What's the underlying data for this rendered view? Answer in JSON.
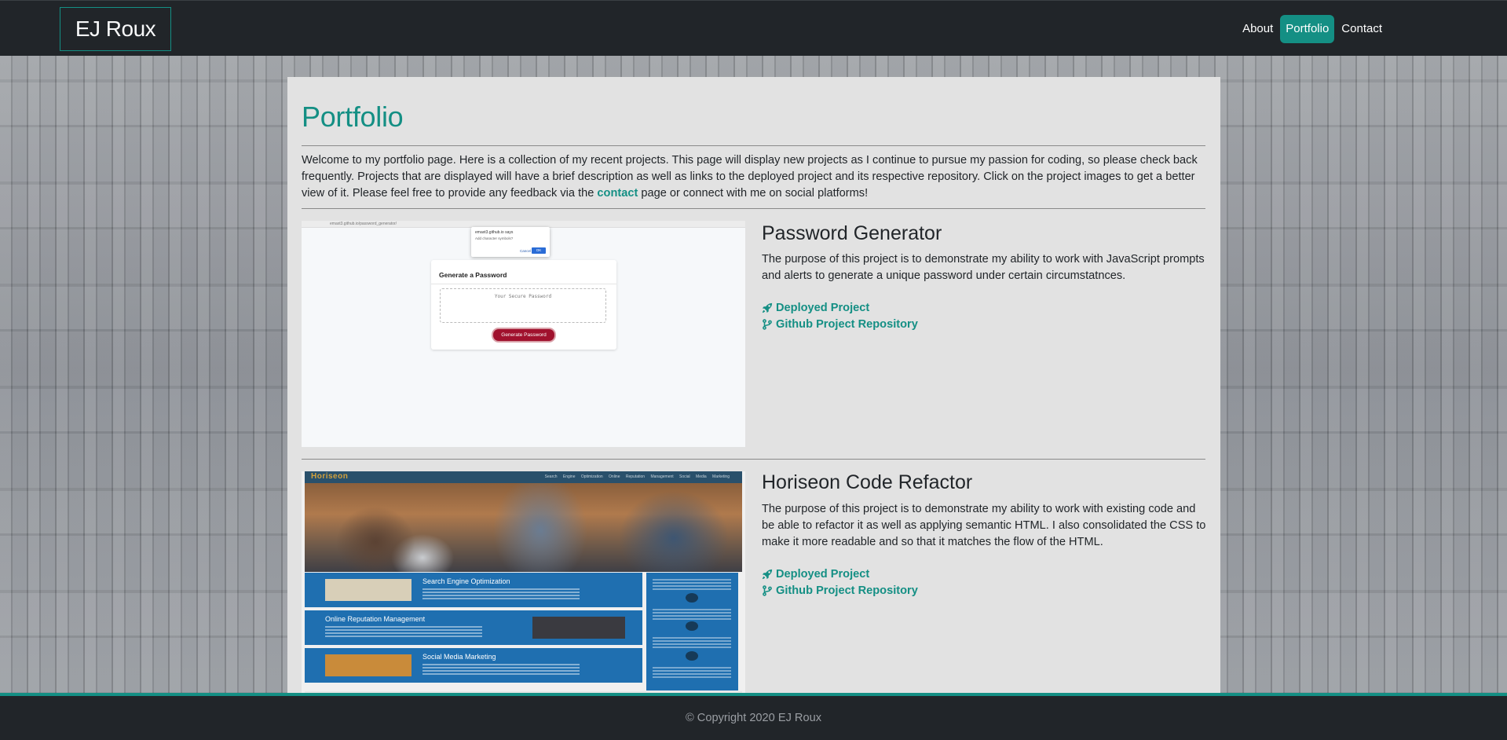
{
  "navbar": {
    "brand": "EJ Roux",
    "links": [
      {
        "label": "About",
        "active": false
      },
      {
        "label": "Portfolio",
        "active": true
      },
      {
        "label": "Contact",
        "active": false
      }
    ]
  },
  "main": {
    "title": "Portfolio",
    "intro_before": "Welcome to my portfolio page. Here is a collection of my recent projects. This page will display new projects as I continue to pursue my passion for coding, so please check back frequently. Projects that are displayed will have a brief description as well as links to the deployed project and its respective repository. Click on the project images to get a better view of it. Please feel free to provide any feedback via the ",
    "intro_link": "contact",
    "intro_after": " page or connect with me on social platforms!",
    "projects": [
      {
        "title": "Password Generator",
        "description": "The purpose of this project is to demonstrate my ability to work with JavaScript prompts and alerts to generate a unique password under certain circumstatnces.",
        "deployed_label": "Deployed Project",
        "repo_label": "Github Project Repository",
        "screenshot": {
          "url": "emaxt3.github.io/password_generator/",
          "alert_title": "emaxt3.github.io says",
          "alert_text": "Add character symbols?",
          "alert_cancel": "Cancel",
          "alert_ok": "OK",
          "card_heading": "Generate a Password",
          "textarea_placeholder": "Your Secure Password",
          "button_label": "Generate Password"
        }
      },
      {
        "title": "Horiseon Code Refactor",
        "description": "The purpose of this project is to demonstrate my ability to work with existing code and be able to refactor it as well as applying semantic HTML. I also consolidated the CSS to make it more readable and so that it matches the flow of the HTML.",
        "deployed_label": "Deployed Project",
        "repo_label": "Github Project Repository",
        "screenshot": {
          "logo": "Horiseon",
          "nav": "Search Engine Optimization   Online Reputation Management   Social Media Marketing",
          "sections": [
            "Search Engine Optimization",
            "Online Reputation Management",
            "Social Media Marketing"
          ]
        }
      }
    ]
  },
  "footer": {
    "copyright": "© Copyright 2020 EJ Roux"
  },
  "colors": {
    "accent": "#148f84",
    "navbar_bg": "#212529",
    "card_bg": "#e2e2e2"
  },
  "icons": {
    "deployed": "rocket-icon",
    "repo": "code-branch-icon"
  }
}
